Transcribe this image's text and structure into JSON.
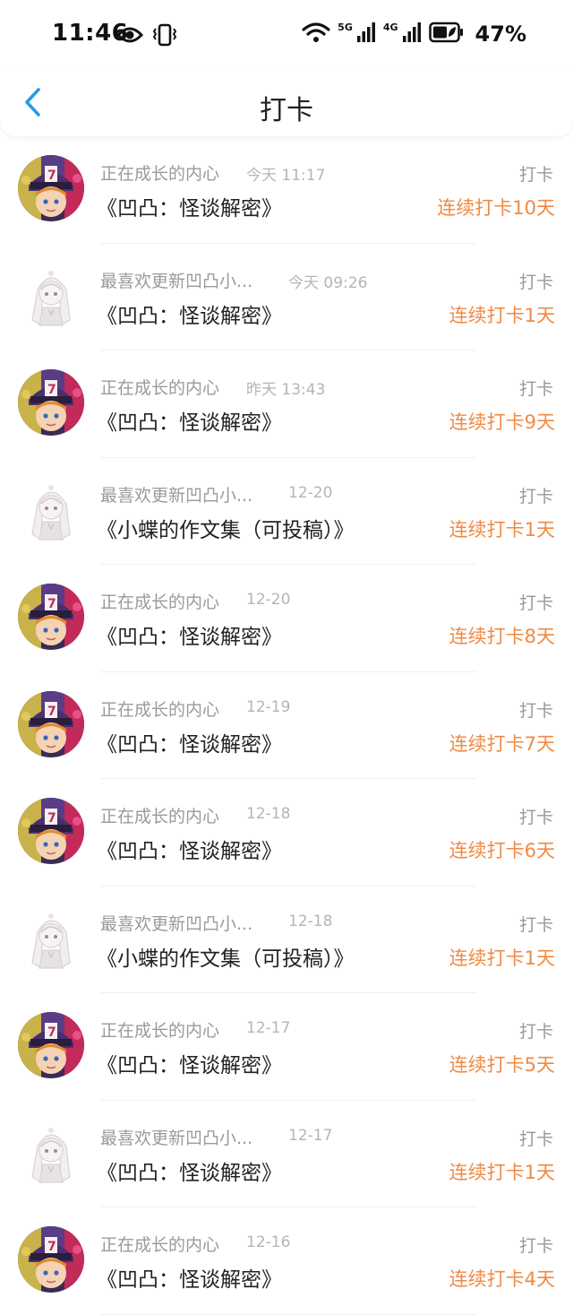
{
  "status_bar": {
    "time": "11:46",
    "net1": "5G",
    "net2": "4G",
    "battery": "47%"
  },
  "header": {
    "title": "打卡"
  },
  "colors": {
    "accent_orange": "#f08a43",
    "back_blue": "#2b9ae8"
  },
  "items": [
    {
      "avatar": "boy",
      "nickname": "正在成长的内心",
      "time": "今天 11:17",
      "title": "《凹凸：怪谈解密》",
      "action": "打卡",
      "streak": "连续打卡10天"
    },
    {
      "avatar": "girl",
      "nickname": "最喜欢更新凹凸小...",
      "time": "今天 09:26",
      "title": "《凹凸：怪谈解密》",
      "action": "打卡",
      "streak": "连续打卡1天"
    },
    {
      "avatar": "boy",
      "nickname": "正在成长的内心",
      "time": "昨天 13:43",
      "title": "《凹凸：怪谈解密》",
      "action": "打卡",
      "streak": "连续打卡9天"
    },
    {
      "avatar": "girl",
      "nickname": "最喜欢更新凹凸小...",
      "time": "12-20",
      "title": "《小蝶的作文集（可投稿）》",
      "action": "打卡",
      "streak": "连续打卡1天"
    },
    {
      "avatar": "boy",
      "nickname": "正在成长的内心",
      "time": "12-20",
      "title": "《凹凸：怪谈解密》",
      "action": "打卡",
      "streak": "连续打卡8天"
    },
    {
      "avatar": "boy",
      "nickname": "正在成长的内心",
      "time": "12-19",
      "title": "《凹凸：怪谈解密》",
      "action": "打卡",
      "streak": "连续打卡7天"
    },
    {
      "avatar": "boy",
      "nickname": "正在成长的内心",
      "time": "12-18",
      "title": "《凹凸：怪谈解密》",
      "action": "打卡",
      "streak": "连续打卡6天"
    },
    {
      "avatar": "girl",
      "nickname": "最喜欢更新凹凸小...",
      "time": "12-18",
      "title": "《小蝶的作文集（可投稿）》",
      "action": "打卡",
      "streak": "连续打卡1天"
    },
    {
      "avatar": "boy",
      "nickname": "正在成长的内心",
      "time": "12-17",
      "title": "《凹凸：怪谈解密》",
      "action": "打卡",
      "streak": "连续打卡5天"
    },
    {
      "avatar": "girl",
      "nickname": "最喜欢更新凹凸小...",
      "time": "12-17",
      "title": "《凹凸：怪谈解密》",
      "action": "打卡",
      "streak": "连续打卡1天"
    },
    {
      "avatar": "boy",
      "nickname": "正在成长的内心",
      "time": "12-16",
      "title": "《凹凸：怪谈解密》",
      "action": "打卡",
      "streak": "连续打卡4天"
    }
  ]
}
